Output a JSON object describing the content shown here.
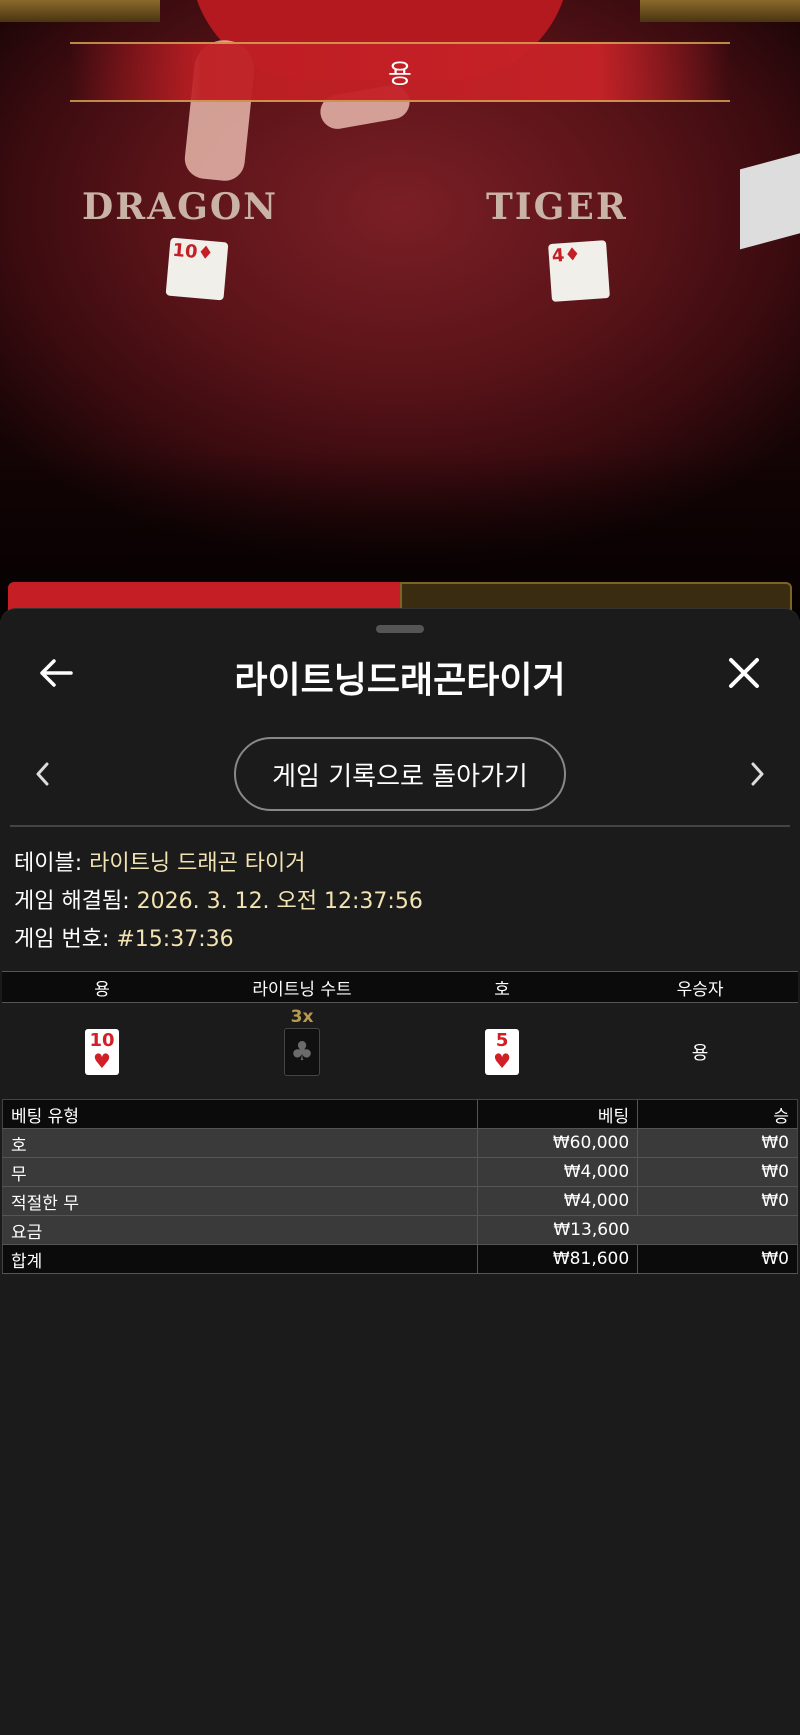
{
  "video": {
    "banner": "용",
    "dragon_label": "DRAGON",
    "tiger_label": "TIGER",
    "dragon_card": "10",
    "tiger_card": "4"
  },
  "sheet": {
    "title": "라이트닝드래곤타이거",
    "back_to_history": "게임 기록으로 돌아가기",
    "info": {
      "table_label": "테이블:",
      "table_value": "라이트닝 드래곤 타이거",
      "resolved_label": "게임 해결됨:",
      "resolved_value": "2026. 3. 12. 오전 12:37:56",
      "number_label": "게임 번호:",
      "number_value": "#15:37:36"
    },
    "result": {
      "headers": [
        "용",
        "라이트닝 수트",
        "호",
        "우승자"
      ],
      "dragon_card": {
        "rank": "10",
        "suit": "♥"
      },
      "lightning": {
        "multiplier": "3x",
        "suit": "♣"
      },
      "tiger_card": {
        "rank": "5",
        "suit": "♥"
      },
      "winner": "용"
    },
    "bets": {
      "headers": [
        "베팅 유형",
        "베팅",
        "승"
      ],
      "rows": [
        {
          "type": "호",
          "bet": "₩60,000",
          "win": "₩0"
        },
        {
          "type": "무",
          "bet": "₩4,000",
          "win": "₩0"
        },
        {
          "type": "적절한 무",
          "bet": "₩4,000",
          "win": "₩0"
        },
        {
          "type": "요금",
          "bet": "₩13,600",
          "win": ""
        }
      ],
      "total": {
        "type": "합계",
        "bet": "₩81,600",
        "win": "₩0"
      }
    }
  },
  "colors": {
    "info_value": "#f2e3b2",
    "dragon_red": "#c51e25",
    "tiger_gold": "#7e6326",
    "multiplier": "#b79a4f"
  }
}
